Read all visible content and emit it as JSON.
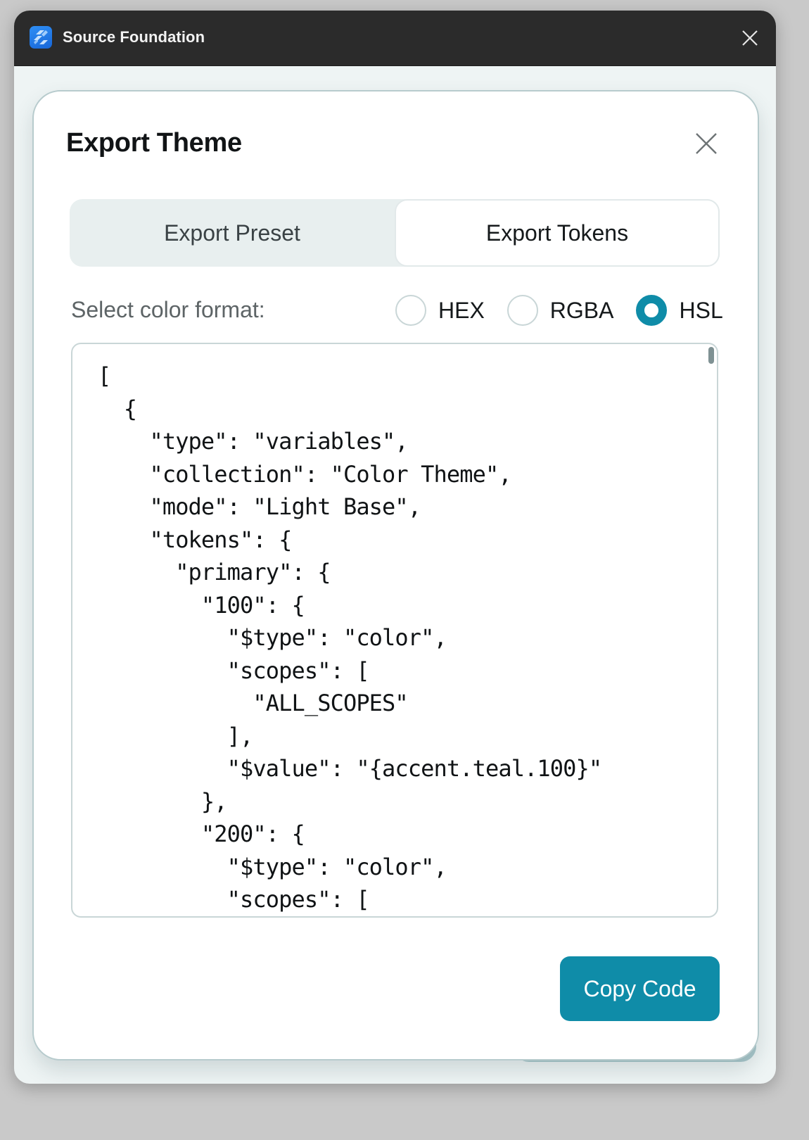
{
  "window": {
    "app_title": "Source Foundation",
    "app_icon": "source-foundation-logo-icon",
    "close_icon": "close-icon"
  },
  "dialog": {
    "title": "Export Theme",
    "close_icon": "close-icon",
    "tabs": [
      {
        "label": "Export Preset",
        "active": false
      },
      {
        "label": "Export Tokens",
        "active": true
      }
    ],
    "format": {
      "label": "Select color format:",
      "options": [
        {
          "label": "HEX",
          "checked": false
        },
        {
          "label": "RGBA",
          "checked": false
        },
        {
          "label": "HSL",
          "checked": true
        }
      ],
      "selected": "HSL"
    },
    "code_lines": [
      "[",
      "  {",
      "    \"type\": \"variables\",",
      "    \"collection\": \"Color Theme\",",
      "    \"mode\": \"Light Base\",",
      "    \"tokens\": {",
      "      \"primary\": {",
      "        \"100\": {",
      "          \"$type\": \"color\",",
      "          \"scopes\": [",
      "            \"ALL_SCOPES\"",
      "          ],",
      "          \"$value\": \"{accent.teal.100}\"",
      "        },",
      "        \"200\": {",
      "          \"$type\": \"color\",",
      "          \"scopes\": ["
    ],
    "copy_button_label": "Copy Code"
  },
  "colors": {
    "accent": "#0f8ca8",
    "titlebar": "#2b2b2b",
    "background": "#eef4f4",
    "border": "#c9d6d7"
  }
}
